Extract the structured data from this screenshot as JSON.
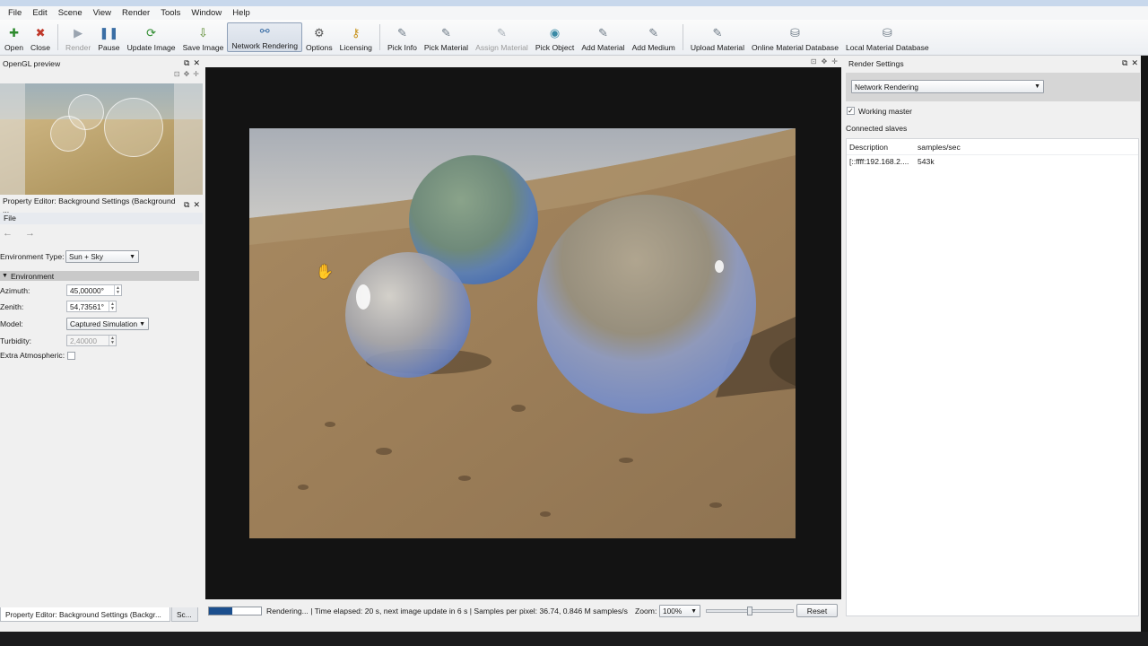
{
  "menu": [
    "File",
    "Edit",
    "Scene",
    "View",
    "Render",
    "Tools",
    "Window",
    "Help"
  ],
  "toolbar": [
    {
      "label": "Open",
      "icon": "plus-icon",
      "glyph": "✚",
      "color": "#2e8b2e",
      "state": "normal"
    },
    {
      "label": "Close",
      "icon": "close-icon",
      "glyph": "✖",
      "color": "#c0392b",
      "state": "normal"
    },
    {
      "label": "Render",
      "icon": "play-icon",
      "glyph": "▶",
      "color": "#9aa4b0",
      "state": "disabled"
    },
    {
      "label": "Pause",
      "icon": "pause-icon",
      "glyph": "❚❚",
      "color": "#3a6ea5",
      "state": "normal"
    },
    {
      "label": "Update Image",
      "icon": "refresh-icon",
      "glyph": "⟳",
      "color": "#2e8b2e",
      "state": "normal"
    },
    {
      "label": "Save Image",
      "icon": "download-icon",
      "glyph": "⇩",
      "color": "#5a8a2e",
      "state": "normal"
    },
    {
      "label": "Network Rendering",
      "icon": "network-icon",
      "glyph": "⚯",
      "color": "#3a6ea5",
      "state": "active"
    },
    {
      "label": "Options",
      "icon": "gear-icon",
      "glyph": "⚙",
      "color": "#555555",
      "state": "normal"
    },
    {
      "label": "Licensing",
      "icon": "key-icon",
      "glyph": "⚷",
      "color": "#c8931c",
      "state": "normal"
    },
    {
      "label": "Pick Info",
      "icon": "eyedropper-icon",
      "glyph": "✎",
      "color": "#6d7a86",
      "state": "normal"
    },
    {
      "label": "Pick Material",
      "icon": "eyedropper-icon",
      "glyph": "✎",
      "color": "#6d7a86",
      "state": "normal"
    },
    {
      "label": "Assign Material",
      "icon": "assign-icon",
      "glyph": "✎",
      "color": "#a8b0b8",
      "state": "disabled"
    },
    {
      "label": "Pick Object",
      "icon": "eye-icon",
      "glyph": "◉",
      "color": "#3a8aa5",
      "state": "normal"
    },
    {
      "label": "Add Material",
      "icon": "add-material-icon",
      "glyph": "✎",
      "color": "#6d7a86",
      "state": "normal"
    },
    {
      "label": "Add Medium",
      "icon": "add-medium-icon",
      "glyph": "✎",
      "color": "#6d7a86",
      "state": "normal"
    },
    {
      "label": "Upload Material",
      "icon": "upload-icon",
      "glyph": "✎",
      "color": "#6d7a86",
      "state": "normal"
    },
    {
      "label": "Online Material Database",
      "icon": "database-icon",
      "glyph": "⛁",
      "color": "#6d7a86",
      "state": "normal"
    },
    {
      "label": "Local Material Database",
      "icon": "database-icon",
      "glyph": "⛁",
      "color": "#6d7a86",
      "state": "normal"
    }
  ],
  "opengl_preview": {
    "title": "OpenGL preview"
  },
  "property_editor": {
    "title": "Property Editor: Background Settings (Background ...",
    "file_menu": "File",
    "environment_type_label": "Environment Type:",
    "environment_type_value": "Sun + Sky",
    "section_label": "Environment",
    "azimuth_label": "Azimuth:",
    "azimuth_value": "45,00000°",
    "zenith_label": "Zenith:",
    "zenith_value": "54,73561°",
    "model_label": "Model:",
    "model_value": "Captured Simulation",
    "turbidity_label": "Turbidity:",
    "turbidity_value": "2,40000",
    "extra_atmospheric_label": "Extra Atmospheric:",
    "extra_atmospheric_checked": false
  },
  "status": {
    "progress": 0.45,
    "text": "Rendering... | Time elapsed: 20 s, next image update in 6 s | Samples per pixel: 36.74, 0.846 M samples/s",
    "zoom_label": "Zoom:",
    "zoom_value": "100%",
    "zoom_slider": 0.5,
    "reset_label": "Reset"
  },
  "render_settings": {
    "title": "Render Settings",
    "mode_value": "Network Rendering",
    "working_master_label": "Working master",
    "working_master_checked": true,
    "connected_slaves_label": "Connected slaves",
    "columns": [
      "Description",
      "samples/sec"
    ],
    "rows": [
      {
        "description": "[::ffff:192.168.2....",
        "samples": "543k"
      }
    ]
  },
  "bottom_tabs": [
    "Property Editor: Background Settings (Backgr...",
    "Sc..."
  ]
}
